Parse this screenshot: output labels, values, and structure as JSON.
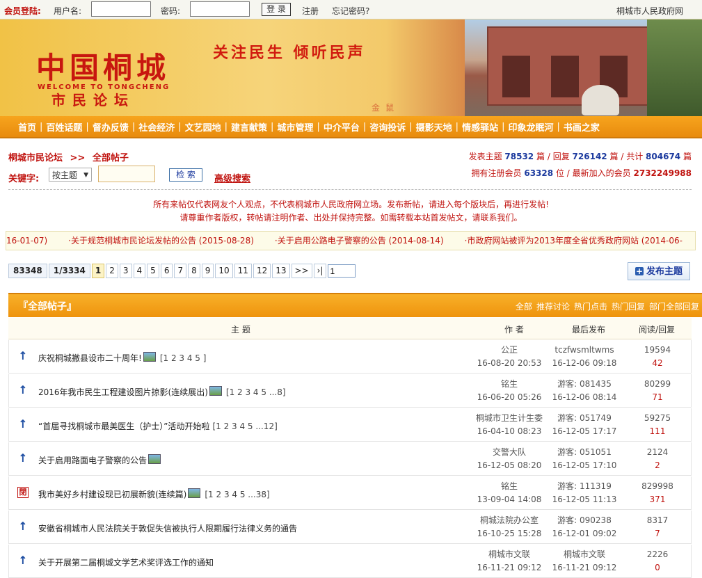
{
  "login": {
    "label": "会员登陆:",
    "username_label": "用户名:",
    "password_label": "密码:",
    "login_button": "登 录",
    "register": "注册",
    "forgot": "忘记密码?",
    "site_link": "桐城市人民政府网"
  },
  "banner": {
    "logo_cn": "中国桐城",
    "logo_en": "WELCOME TO TONGCHENG",
    "slogan": "关注民生  倾听民声",
    "forum": "市民论坛",
    "stamp": "金鼠"
  },
  "nav": [
    "首页",
    "百姓话题",
    "督办反馈",
    "社会经济",
    "文艺园地",
    "建言献策",
    "城市管理",
    "中介平台",
    "咨询投诉",
    "摄影天地",
    "情感驿站",
    "印象龙眠河",
    "书画之家"
  ],
  "breadcrumb": {
    "forum": "桐城市民论坛",
    "sep": ">>",
    "current": "全部帖子"
  },
  "stats": {
    "topics_label": "发表主题",
    "topics": "78532",
    "unit_pian": "篇",
    "replies_label": "回复",
    "replies": "726142",
    "total_label": "共计",
    "total": "804674",
    "members_label": "拥有注册会员",
    "members": "63328",
    "unit_wei": "位",
    "newest_label": "最新加入的会员",
    "newest": "2732249988",
    "slash": "/"
  },
  "search": {
    "label": "关键字:",
    "select_value": "按主题",
    "button": "检 索",
    "advanced": "高级搜索"
  },
  "notice": {
    "line1": "所有来帖仅代表网友个人观点，不代表桐城市人民政府网立场。发布新帖，请进入每个版块后，再进行发帖!",
    "line2": "请尊重作者版权，转帖请注明作者、出处并保持完整。如需转载本站首发帖文，请联系我们。"
  },
  "ticker": [
    "16-01-07)",
    "·关于规范桐城市民论坛发帖的公告 (2015-08-28)",
    "·关于启用公路电子警察的公告 (2014-08-14)",
    "·市政府网站被评为2013年度全省优秀政府网站 (2014-06-"
  ],
  "pager": {
    "total": "83348",
    "pages": "1/3334",
    "items": [
      "1",
      "2",
      "3",
      "4",
      "5",
      "6",
      "7",
      "8",
      "9",
      "10",
      "11",
      "12",
      "13",
      ">>",
      "›|"
    ],
    "jump_value": "1"
  },
  "new_topic_button": "发布主题",
  "section": {
    "title": "『全部帖子』",
    "links": [
      "全部",
      "推荐讨论",
      "热门点击",
      "热门回复",
      "部门全部回复"
    ]
  },
  "columns": {
    "subject": "主    题",
    "author": "作 者",
    "last": "最后发布",
    "stats": "阅读/回复"
  },
  "rows": [
    {
      "icon": "↑",
      "subject": "庆祝桐城撤县设市二十周年!",
      "pages": "[1 2 3 4 5 ]",
      "author": "公正",
      "posted": "16-08-20 20:53",
      "last_user": "tczfwsmltwms",
      "last_time": "16-12-06 09:18",
      "reads": "19594",
      "replies": "42",
      "img": true
    },
    {
      "icon": "↑",
      "subject": "2016年我市民生工程建设图片掠影(连续展出)",
      "pages": "[1 2 3 4 5 ...8]",
      "author": "铭生",
      "posted": "16-06-20 05:26",
      "last_user": "游客: 081435",
      "last_time": "16-12-06 08:14",
      "reads": "80299",
      "replies": "71",
      "img": true
    },
    {
      "icon": "↑",
      "subject": "“首届寻找桐城市最美医生（护士）”活动开始啦",
      "pages": "[1 2 3 4 5 ...12]",
      "author": "桐城市卫生计生委",
      "posted": "16-04-10 08:23",
      "last_user": "游客: 051749",
      "last_time": "16-12-05 17:17",
      "reads": "59275",
      "replies": "111",
      "img": false
    },
    {
      "icon": "↑",
      "subject": "关于启用路面电子警察的公告",
      "pages": "",
      "author": "交警大队",
      "posted": "16-12-05 08:20",
      "last_user": "游客: 051051",
      "last_time": "16-12-05 17:10",
      "reads": "2124",
      "replies": "2",
      "img": true
    },
    {
      "icon": "閉",
      "subject": "我市美好乡村建设现已初展新貌(连续篇)",
      "pages": "[1 2 3 4 5 ...38]",
      "author": "铭生",
      "posted": "13-09-04 14:08",
      "last_user": "游客: 111319",
      "last_time": "16-12-05 11:13",
      "reads": "829998",
      "replies": "371",
      "img": true
    },
    {
      "icon": "↑",
      "subject": "安徽省桐城市人民法院关于敦促失信被执行人限期履行法律义务的通告",
      "pages": "",
      "author": "桐城法院办公室",
      "posted": "16-10-25 15:28",
      "last_user": "游客: 090238",
      "last_time": "16-12-01 09:02",
      "reads": "8317",
      "replies": "7",
      "img": false
    },
    {
      "icon": "↑",
      "subject": "关于开展第二届桐城文学艺术奖评选工作的通知",
      "pages": "",
      "author": "桐城市文联",
      "posted": "16-11-21 09:12",
      "last_user": "桐城市文联",
      "last_time": "16-11-21 09:12",
      "reads": "2226",
      "replies": "0",
      "img": false
    }
  ]
}
